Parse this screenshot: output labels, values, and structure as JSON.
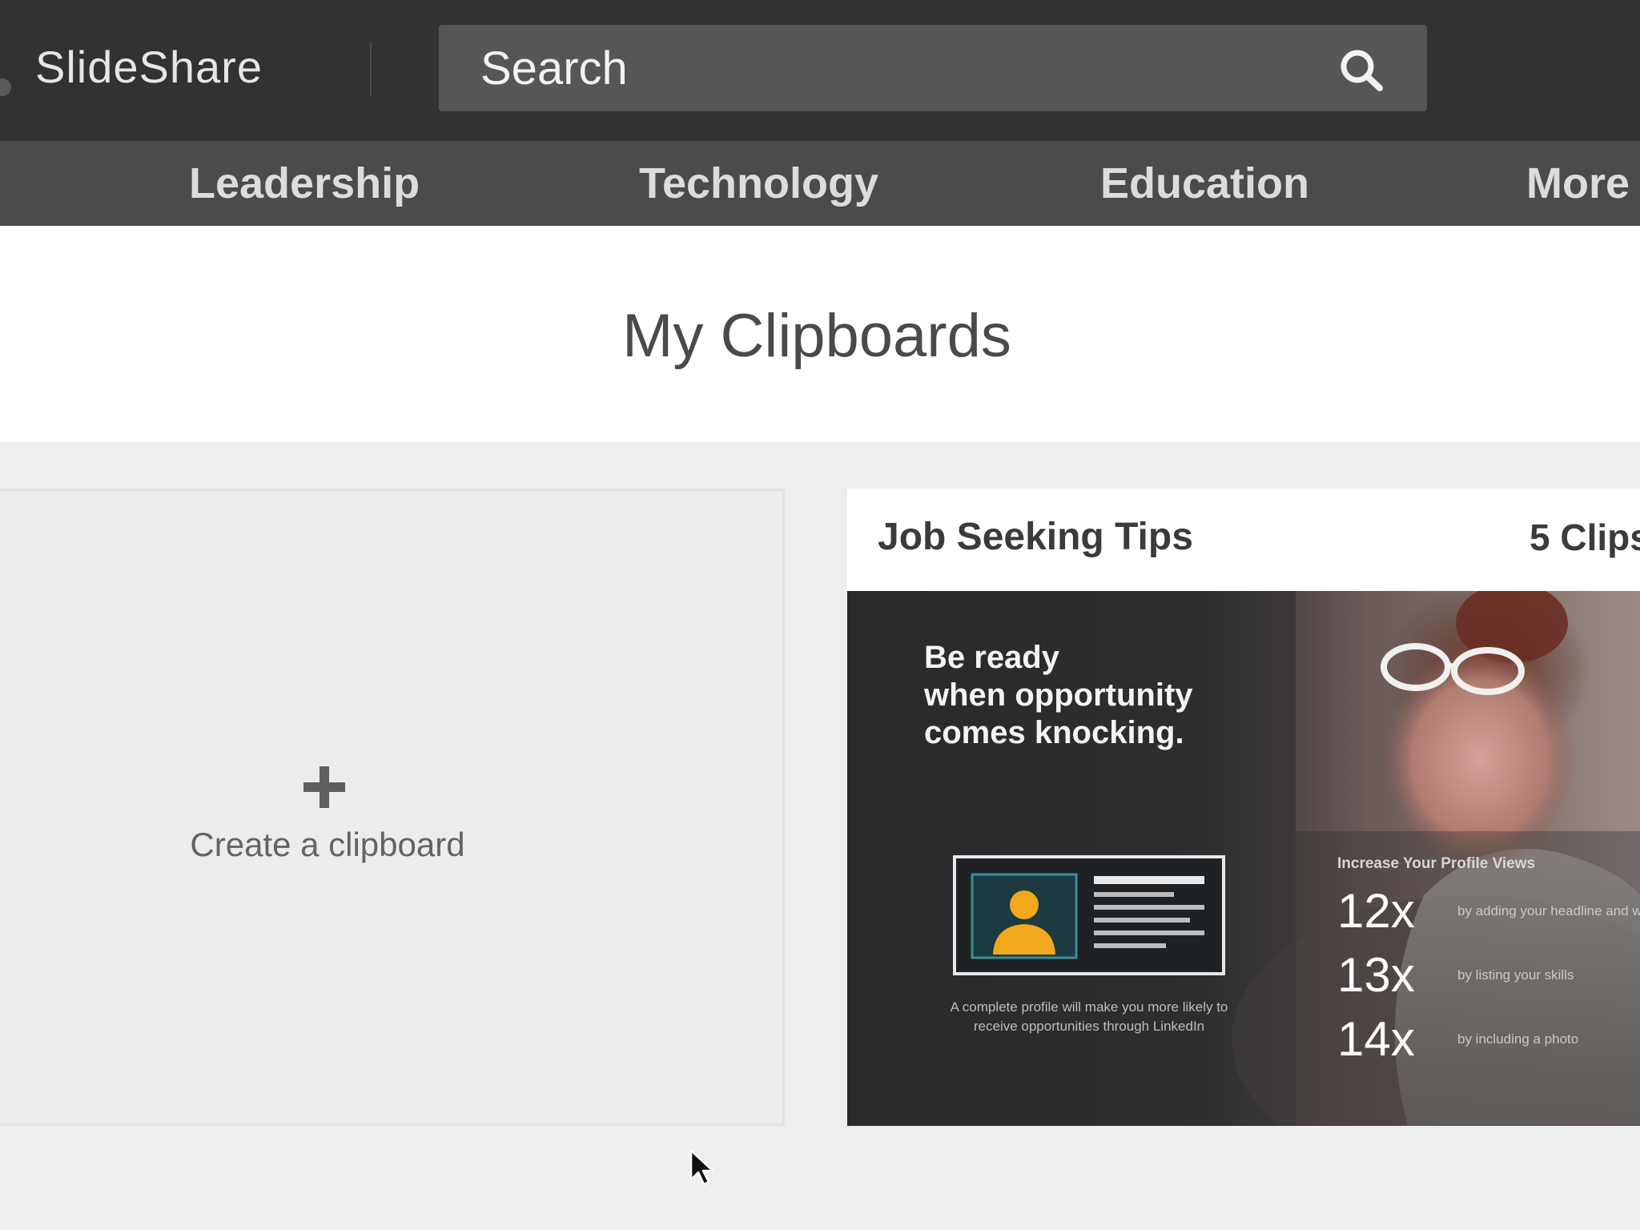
{
  "header": {
    "logo": "SlideShare",
    "search_placeholder": "Search"
  },
  "nav": {
    "categories": [
      "Leadership",
      "Technology",
      "Education",
      "More"
    ]
  },
  "page": {
    "title": "My Clipboards"
  },
  "create_card": {
    "label": "Create a clipboard"
  },
  "clipboard": {
    "title": "Job Seeking Tips",
    "count": "5 Clips",
    "thumbnail": {
      "headline": [
        "Be ready",
        "when opportunity",
        "comes knocking."
      ],
      "footnote": "A complete profile will make you more likely to receive opportunities through LinkedIn",
      "stats_heading": "Increase Your Profile Views",
      "stats": [
        {
          "value": "12x",
          "desc": "by adding your headline and work positions"
        },
        {
          "value": "13x",
          "desc": "by listing your skills"
        },
        {
          "value": "14x",
          "desc": "by including a photo"
        }
      ]
    }
  },
  "colors": {
    "topbar": "#323232",
    "navbar": "#4b4b4b",
    "page_bg": "#efeeee",
    "accent_profile": "#f2a81d"
  }
}
